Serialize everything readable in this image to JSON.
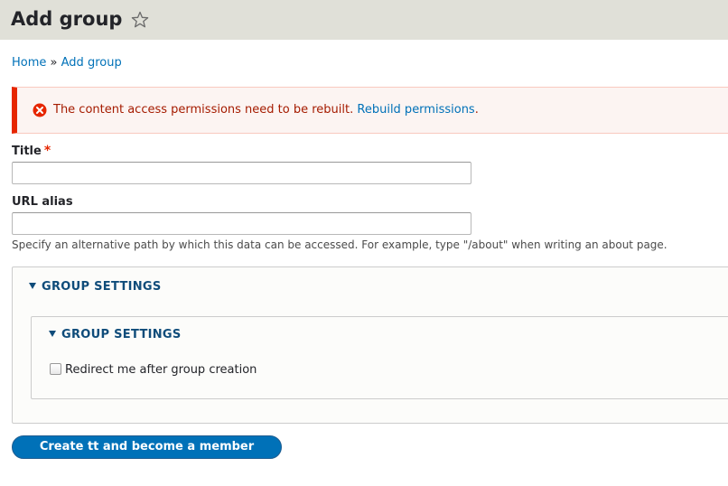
{
  "header": {
    "title": "Add group"
  },
  "breadcrumb": {
    "home": "Home",
    "separator": "»",
    "current": "Add group"
  },
  "message": {
    "text": "The content access permissions need to be rebuilt.",
    "link": "Rebuild permissions",
    "link_suffix": ".",
    "status_color": "#e62600"
  },
  "form": {
    "title_label": "Title",
    "required_marker": "*",
    "title_value": "",
    "url_alias_label": "URL alias",
    "url_alias_value": "",
    "url_alias_description": "Specify an alternative path by which this data can be accessed. For example, type \"/about\" when writing an about page.",
    "outer_details_summary": "GROUP SETTINGS",
    "inner_details_summary": "GROUP SETTINGS",
    "redirect_checkbox_label": "Redirect me after group creation",
    "redirect_checked": false,
    "submit_label": "Create tt and become a member"
  },
  "colors": {
    "accent": "#0071b8",
    "header_bg": "#e0e0d8",
    "error": "#e62600"
  },
  "icons": [
    "star-icon",
    "error-icon",
    "triangle-down-icon"
  ]
}
